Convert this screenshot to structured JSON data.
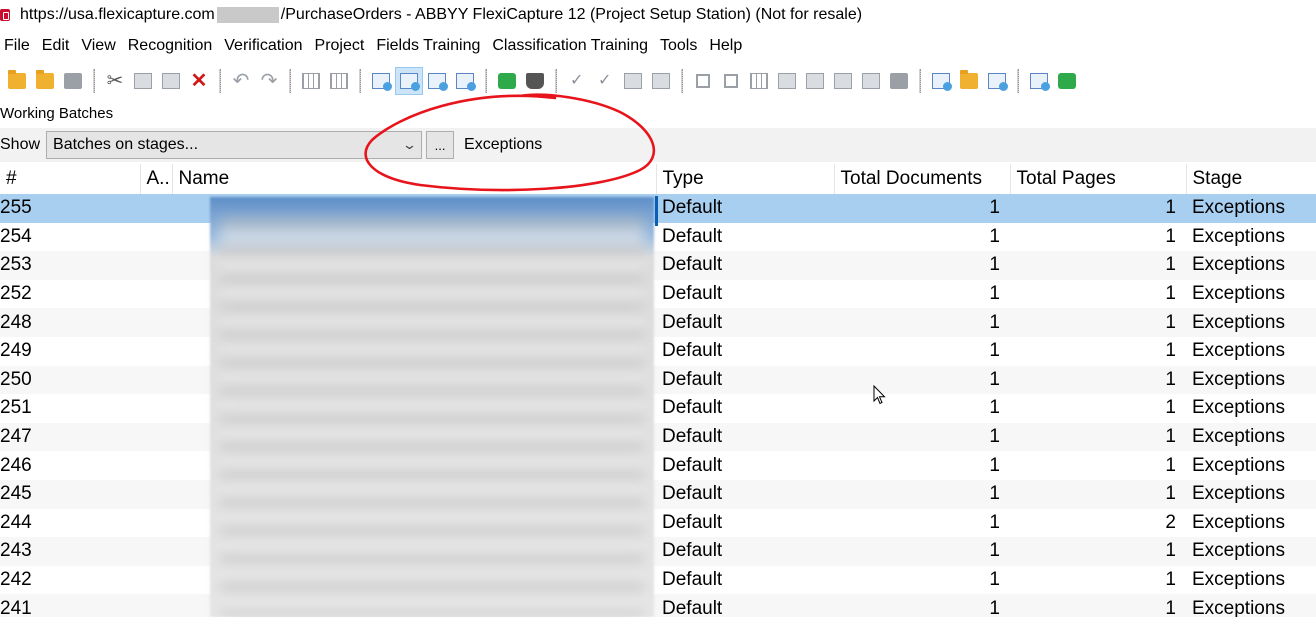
{
  "window": {
    "title_prefix": "https://usa.flexicapture.com",
    "title_suffix": "/PurchaseOrders - ABBYY FlexiCapture 12 (Project Setup Station) (Not for resale)"
  },
  "menu": [
    "File",
    "Edit",
    "View",
    "Recognition",
    "Verification",
    "Project",
    "Fields Training",
    "Classification Training",
    "Tools",
    "Help"
  ],
  "panel_caption": "Working Batches",
  "show_bar": {
    "label": "Show",
    "selected": "Batches on stages...",
    "ellipsis": "...",
    "stage_filter": "Exceptions"
  },
  "columns": [
    "#",
    "A..",
    "Name",
    "Type",
    "Total Documents",
    "Total Pages",
    "Stage"
  ],
  "rows": [
    {
      "id": "255",
      "type": "Default",
      "docs": "1",
      "pages": "1",
      "stage": "Exceptions"
    },
    {
      "id": "254",
      "type": "Default",
      "docs": "1",
      "pages": "1",
      "stage": "Exceptions"
    },
    {
      "id": "253",
      "type": "Default",
      "docs": "1",
      "pages": "1",
      "stage": "Exceptions"
    },
    {
      "id": "252",
      "type": "Default",
      "docs": "1",
      "pages": "1",
      "stage": "Exceptions"
    },
    {
      "id": "248",
      "type": "Default",
      "docs": "1",
      "pages": "1",
      "stage": "Exceptions"
    },
    {
      "id": "249",
      "type": "Default",
      "docs": "1",
      "pages": "1",
      "stage": "Exceptions"
    },
    {
      "id": "250",
      "type": "Default",
      "docs": "1",
      "pages": "1",
      "stage": "Exceptions"
    },
    {
      "id": "251",
      "type": "Default",
      "docs": "1",
      "pages": "1",
      "stage": "Exceptions"
    },
    {
      "id": "247",
      "type": "Default",
      "docs": "1",
      "pages": "1",
      "stage": "Exceptions"
    },
    {
      "id": "246",
      "type": "Default",
      "docs": "1",
      "pages": "1",
      "stage": "Exceptions"
    },
    {
      "id": "245",
      "type": "Default",
      "docs": "1",
      "pages": "1",
      "stage": "Exceptions"
    },
    {
      "id": "244",
      "type": "Default",
      "docs": "1",
      "pages": "2",
      "stage": "Exceptions"
    },
    {
      "id": "243",
      "type": "Default",
      "docs": "1",
      "pages": "1",
      "stage": "Exceptions"
    },
    {
      "id": "242",
      "type": "Default",
      "docs": "1",
      "pages": "1",
      "stage": "Exceptions"
    },
    {
      "id": "241",
      "type": "Default",
      "docs": "1",
      "pages": "1",
      "stage": "Exceptions"
    }
  ],
  "selected_row": "255",
  "colors": {
    "selection": "#a8cff0",
    "annotation": "#e8141c"
  },
  "icons": [
    "folder-open-icon",
    "save-icon",
    "cut-icon",
    "copy-icon",
    "paste-icon",
    "delete-icon",
    "undo-icon",
    "redo-icon",
    "batch-folder-icon",
    "cursor-icon"
  ]
}
